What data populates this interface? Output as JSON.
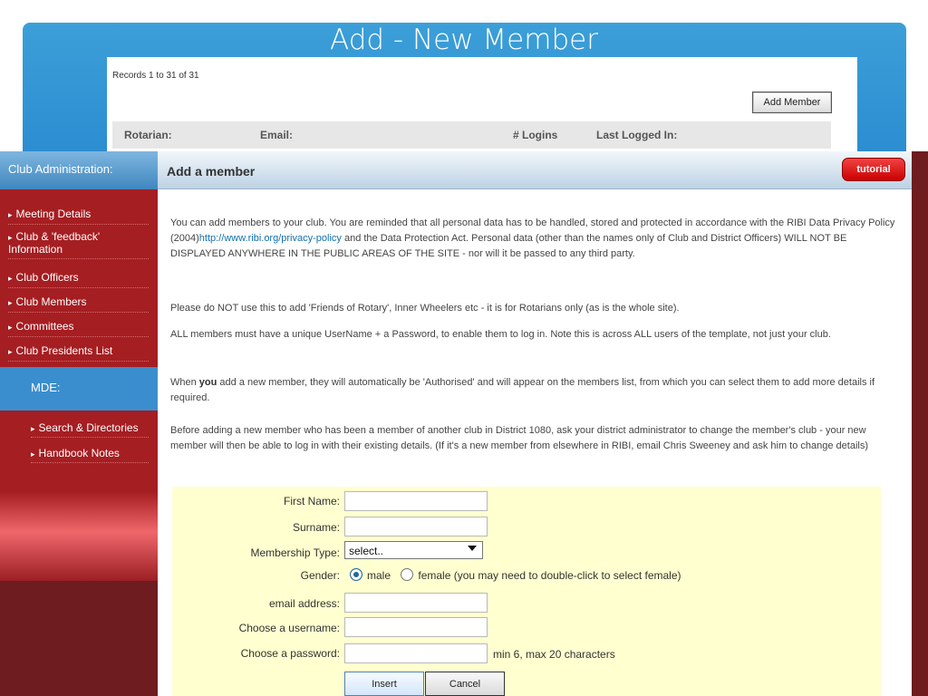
{
  "slide": {
    "title": "Add - New Member"
  },
  "background": {
    "records": "Records 1 to 31 of 31",
    "add_member_button": "Add Member",
    "columns": [
      "Rotarian:",
      "Email:",
      "# Logins",
      "Last Logged In:"
    ]
  },
  "sidebar": {
    "heading": "Club Administration:",
    "items": [
      "Meeting Details",
      "Club & 'feedback' Information",
      "Club Officers",
      "Club Members",
      "Committees",
      "Club Presidents List"
    ],
    "mde": "MDE:",
    "sub_items": [
      "Search & Directories",
      "Handbook Notes"
    ]
  },
  "main": {
    "title": "Add a member",
    "tutorial": "tutorial",
    "paragraph_1_prefix": "You can add members to your club.  You are reminded that all personal data has to be handled, stored and protected in accordance with the RIBI Data Privacy Policy (2004)",
    "privacy_link": "http://www.ribi.org/privacy-policy",
    "paragraph_1_suffix": " and the Data Protection Act. Personal data (other than the names only of Club and District Officers) WILL NOT BE DISPLAYED ANYWHERE IN THE PUBLIC AREAS OF THE SITE - nor will it be passed to any third party.",
    "paragraph_2": "Please do NOT use this to add 'Friends of Rotary', Inner Wheelers etc - it is for Rotarians only (as is the whole site).",
    "paragraph_3": "ALL members must have a unique UserName + a Password, to enable them to log in. Note this is across ALL users of the template, not just your club.",
    "paragraph_4_prefix": "When ",
    "paragraph_4_bold": "you",
    "paragraph_4_suffix": " add a new member, they will automatically be 'Authorised' and will appear on the members list, from which you can select them to add more details if required.",
    "paragraph_5": "Before adding a new member who has been a member of another club in District 1080, ask your district administrator to change the member's club - your new member will then be able to log in with their existing details. (If it's a new member from elsewhere in RIBI, email Chris Sweeney and ask him to change details)"
  },
  "form": {
    "first_name_label": "First Name:",
    "surname_label": "Surname:",
    "membership_type_label": "Membership Type:",
    "membership_type_value": "select..",
    "gender_label": "Gender:",
    "male_label": "male",
    "female_label": "female (you may need to double-click to select female)",
    "email_label": "email address:",
    "username_label": "Choose a username:",
    "password_label": "Choose a password:",
    "password_hint": "min 6, max 20 characters",
    "insert_button": "Insert",
    "cancel_button": "Cancel",
    "first_name_value": "",
    "surname_value": "",
    "email_value": "",
    "username_value": "",
    "password_value": ""
  },
  "colors": {
    "slide_blue": "#3c9fd8",
    "sidebar_red": "#a51e22",
    "sidebar_dark": "#6e1c1f",
    "form_background": "#ffffd0",
    "tutorial_red": "#d80000"
  }
}
